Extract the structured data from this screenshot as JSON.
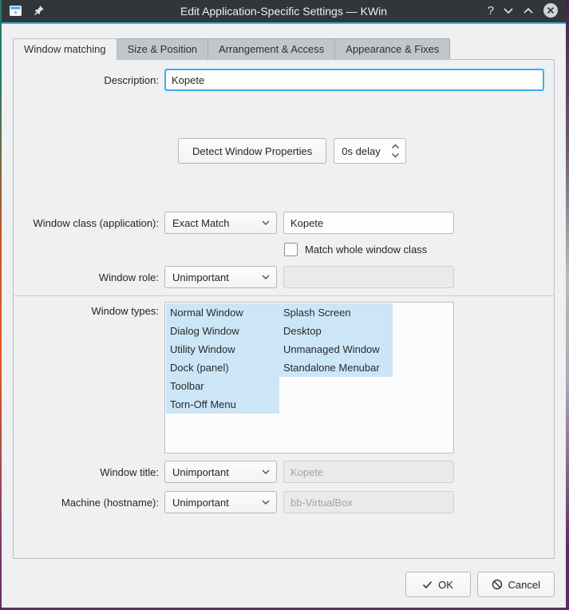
{
  "titlebar": {
    "title": "Edit Application-Specific Settings — KWin",
    "icons": [
      "app-window-icon",
      "pin-icon",
      "help-icon",
      "chevron-down-icon",
      "chevron-up-icon",
      "close-icon"
    ],
    "help_glyph": "?"
  },
  "tabs": [
    {
      "label": "Window matching",
      "active": true
    },
    {
      "label": "Size & Position",
      "active": false
    },
    {
      "label": "Arrangement & Access",
      "active": false
    },
    {
      "label": "Appearance & Fixes",
      "active": false
    }
  ],
  "form": {
    "description": {
      "label": "Description:",
      "value": "Kopete"
    },
    "detect": {
      "button_label": "Detect Window Properties",
      "delay_value": "0s delay"
    },
    "window_class": {
      "label": "Window class (application):",
      "match_mode": "Exact Match",
      "value": "Kopete"
    },
    "match_whole_class": {
      "label": "Match whole window class",
      "checked": false
    },
    "window_role": {
      "label": "Window role:",
      "match_mode": "Unimportant",
      "value": ""
    },
    "window_types": {
      "label": "Window types:",
      "col1": [
        "Normal Window",
        "Dialog Window",
        "Utility Window",
        "Dock (panel)",
        "Toolbar",
        "Torn-Off Menu"
      ],
      "col2": [
        "Splash Screen",
        "Desktop",
        "Unmanaged Window",
        "Standalone Menubar"
      ],
      "all_selected": true
    },
    "window_title": {
      "label": "Window title:",
      "match_mode": "Unimportant",
      "value": "Kopete",
      "disabled": true
    },
    "machine": {
      "label": "Machine (hostname):",
      "match_mode": "Unimportant",
      "value": "bb-VirtualBox",
      "disabled": true
    }
  },
  "footer": {
    "ok_label": "OK",
    "cancel_label": "Cancel"
  },
  "colors": {
    "accent": "#3daee9",
    "titlebar_bg": "#31363b",
    "dialog_bg": "#eff0f1",
    "selection_bg": "#cde6f7",
    "desktop_edge_purple": "#5d2c62"
  }
}
